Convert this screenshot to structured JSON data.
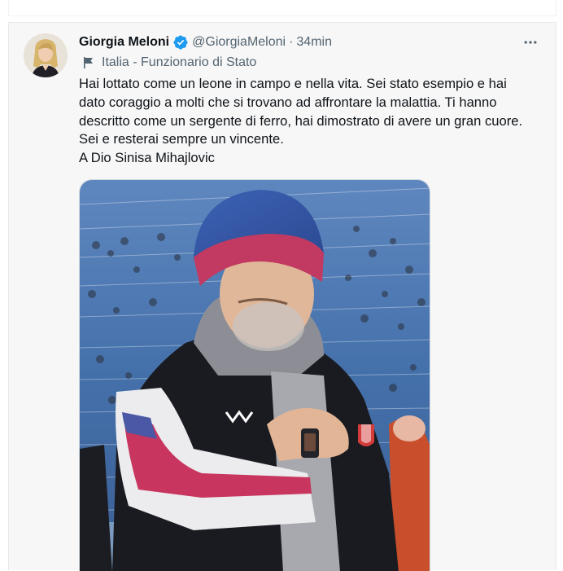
{
  "tweet": {
    "author_name": "Giorgia Meloni",
    "handle": "@GiorgiaMeloni",
    "separator": "·",
    "time": "34min",
    "label": "Italia - Funzionario di Stato",
    "text_lines": [
      "Hai lottato come un leone in campo e nella vita. Sei stato esempio e hai",
      "dato coraggio a molti che si trovano ad affrontare la malattia. Ti hanno",
      "descritto come un sergente di ferro, hai dimostrato di avere un gran cuore.",
      "Sei e resterai sempre un vincente.",
      "A Dio Sinisa Mihajlovic"
    ],
    "icons": {
      "verified": "verified-badge-icon",
      "label": "flag-icon",
      "more": "more-icon"
    },
    "colors": {
      "verified_blue": "#1d9bf0",
      "text": "#0f1419",
      "secondary": "#536471",
      "card_bg": "#f7f7f7"
    }
  }
}
